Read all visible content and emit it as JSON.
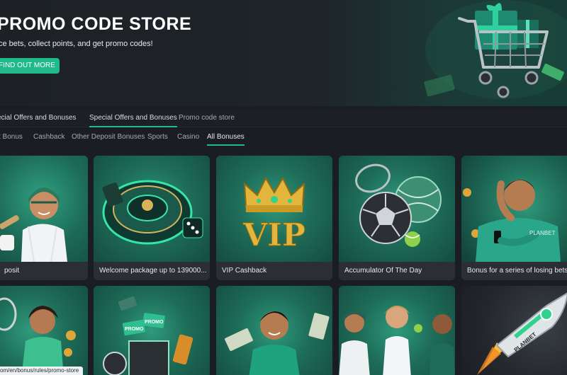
{
  "hero": {
    "title": "PROMO CODE STORE",
    "subtitle": "ce bets, collect points, and get promo codes!",
    "button_label": "FIND OUT MORE"
  },
  "tabs_primary": [
    {
      "label": "ecial Offers and Bonuses"
    },
    {
      "label": "Special Offers and Bonuses"
    },
    {
      "label": "Promo code store"
    }
  ],
  "tabs_secondary": [
    {
      "label": "t Bonus"
    },
    {
      "label": "Cashback"
    },
    {
      "label": "Other Deposit Bonuses"
    },
    {
      "label": "Sports"
    },
    {
      "label": "Casino"
    },
    {
      "label": "All Bonuses"
    }
  ],
  "cards_row1": [
    {
      "caption": "posit"
    },
    {
      "caption": "Welcome package up to 139000..."
    },
    {
      "caption": "VIP Cashback"
    },
    {
      "caption": "Accumulator Of The Day"
    },
    {
      "caption": "Bonus for a series of losing bets"
    }
  ],
  "card_texts": {
    "vip": "VIP",
    "planbet": "PLANBET",
    "promo": "PROMO"
  },
  "status_url": "om/en/bonus/rules/promo-store",
  "colors": {
    "accent": "#1fb98a",
    "background": "#1a1d21",
    "card_caption": "#2b2f34"
  }
}
